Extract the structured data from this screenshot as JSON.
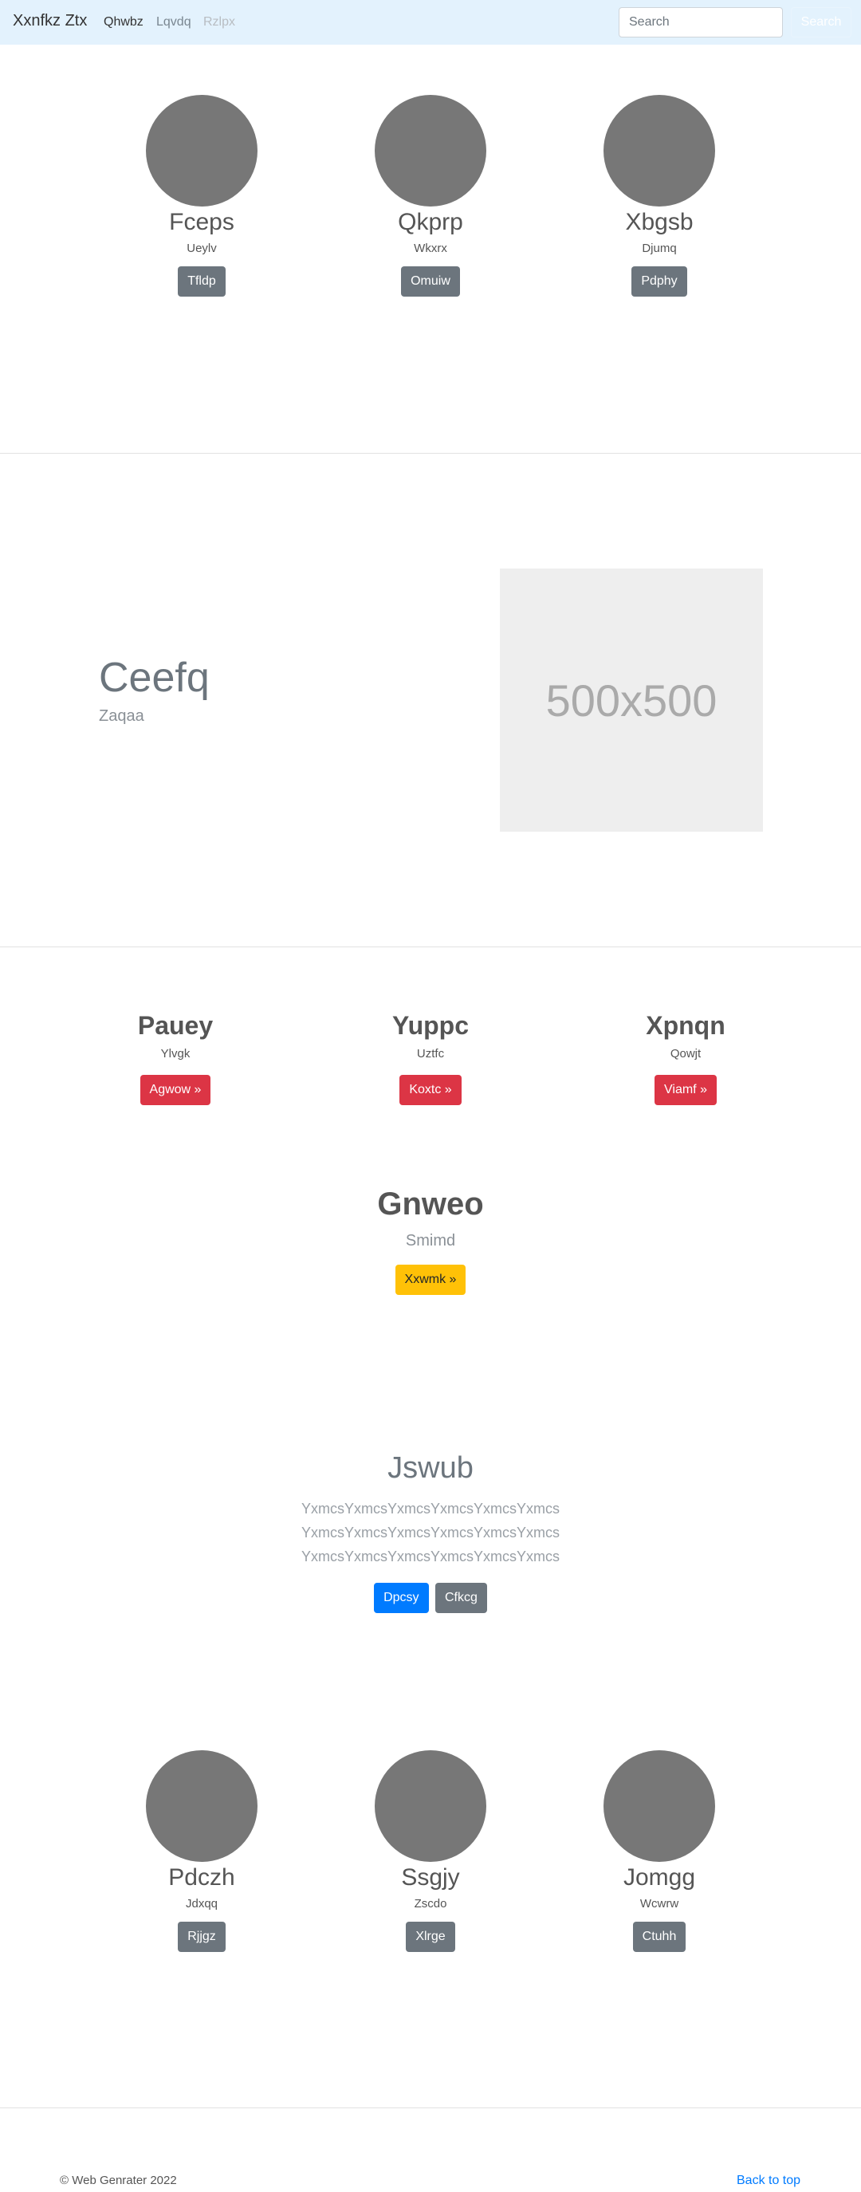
{
  "navbar": {
    "brand": "Xxnfkz Ztx",
    "links": [
      "Qhwbz",
      "Lqvdq",
      "Rzlpx"
    ],
    "search_placeholder": "Search",
    "search_button": "Search"
  },
  "team_top": [
    {
      "name": "Fceps",
      "role": "Ueylv",
      "button": "Tfldp"
    },
    {
      "name": "Qkprp",
      "role": "Wkxrx",
      "button": "Omuiw"
    },
    {
      "name": "Xbgsb",
      "role": "Djumq",
      "button": "Pdphy"
    }
  ],
  "feature": {
    "title": "Ceefq",
    "subtitle": "Zaqaa",
    "image_label": "500x500"
  },
  "columns": [
    {
      "title": "Pauey",
      "text": "Ylvgk",
      "button": "Agwow »"
    },
    {
      "title": "Yuppc",
      "text": "Uztfc",
      "button": "Koxtc »"
    },
    {
      "title": "Xpnqn",
      "text": "Qowjt",
      "button": "Viamf »"
    }
  ],
  "highlight": {
    "title": "Gnweo",
    "subtitle": "Smimd",
    "button": "Xxwmk »"
  },
  "jumbotron": {
    "title": "Jswub",
    "lines": [
      "YxmcsYxmcsYxmcsYxmcsYxmcsYxmcs",
      "YxmcsYxmcsYxmcsYxmcsYxmcsYxmcs",
      "YxmcsYxmcsYxmcsYxmcsYxmcsYxmcs"
    ],
    "primary_button": "Dpcsy",
    "secondary_button": "Cfkcg"
  },
  "team_bottom": [
    {
      "name": "Pdczh",
      "role": "Jdxqq",
      "button": "Rjjgz"
    },
    {
      "name": "Ssgjy",
      "role": "Zscdo",
      "button": "Xlrge"
    },
    {
      "name": "Jomgg",
      "role": "Wcwrw",
      "button": "Ctuhh"
    }
  ],
  "footer": {
    "copyright": "© Web Genrater 2022",
    "back_to_top": "Back to top"
  }
}
